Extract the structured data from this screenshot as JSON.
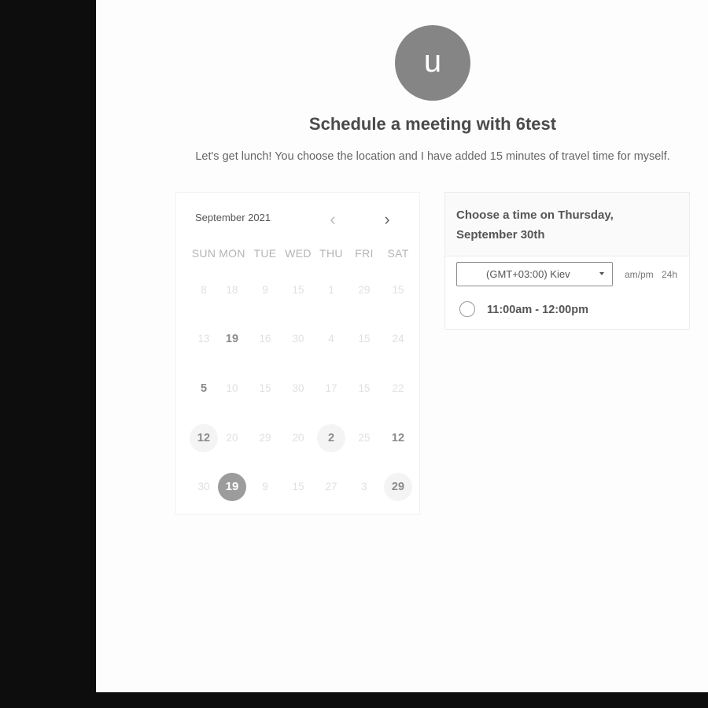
{
  "host": {
    "avatar_letter": "u",
    "title": "Schedule a meeting with 6test",
    "description": "Let's get lunch! You choose the location and I have added 15 minutes of travel time for myself."
  },
  "calendar": {
    "month_label": "September 2021",
    "prev_icon": "chevron-left-icon",
    "next_icon": "chevron-right-icon",
    "prev_glyph": "‹",
    "next_glyph": "›",
    "weekdays": [
      "SUN",
      "MON",
      "TUE",
      "WED",
      "THU",
      "FRI",
      "SAT"
    ],
    "weeks": [
      [
        "8",
        "18",
        "9",
        "15",
        "1",
        "29",
        "15"
      ],
      [
        "13",
        "19",
        "16",
        "30",
        "4",
        "15",
        "24"
      ],
      [
        "5",
        "10",
        "15",
        "30",
        "17",
        "15",
        "22"
      ],
      [
        "12",
        "20",
        "29",
        "20",
        "2",
        "25",
        "12"
      ],
      [
        "30",
        "19",
        "9",
        "15",
        "27",
        "3",
        "29"
      ]
    ],
    "states": [
      [
        "off",
        "off",
        "off",
        "off",
        "off",
        "off",
        "off"
      ],
      [
        "off",
        "avail",
        "off",
        "off",
        "off",
        "off",
        "off"
      ],
      [
        "avail",
        "off",
        "off",
        "off",
        "off",
        "off",
        "off"
      ],
      [
        "avail-bg",
        "off",
        "off",
        "off",
        "avail-bg",
        "off",
        "avail"
      ],
      [
        "off",
        "selected",
        "off",
        "off",
        "off",
        "off",
        "avail-bg"
      ]
    ]
  },
  "time_panel": {
    "title": "Choose a time on Thursday, September 30th",
    "timezone": "(GMT+03:00) Kiev",
    "format_ampm": "am/pm",
    "format_24h": "24h",
    "slots": [
      "11:00am - 12:00pm"
    ]
  },
  "colors": {
    "backdrop": "#0d0d0d",
    "selected_day": "#9c9c9c",
    "avatar": "#858585"
  }
}
